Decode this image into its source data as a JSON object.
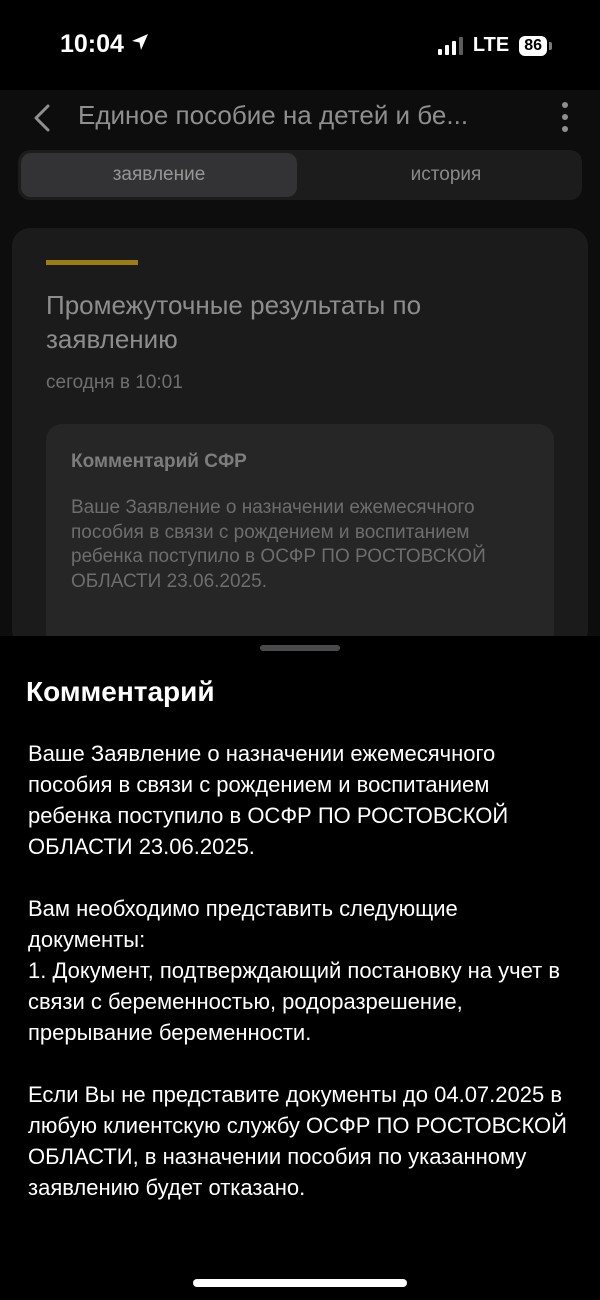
{
  "status_bar": {
    "time": "10:04",
    "network": "LTE",
    "battery": "86",
    "signal_bars_active": 3,
    "signal_bars_total": 4
  },
  "header": {
    "title": "Единое пособие на детей и бе..."
  },
  "tabs": {
    "application_label": "заявление",
    "history_label": "история"
  },
  "result_card": {
    "title": "Промежуточные результаты по заявлению",
    "date": "сегодня в 10:01",
    "comment_label": "Комментарий СФР",
    "comment_preview": "Ваше Заявление о назначении ежемесячного пособия в связи с рождением и воспитанием ребенка поступило в ОСФР ПО РОСТОВСКОЙ ОБЛАСТИ 23.06.2025."
  },
  "sheet": {
    "title": "Комментарий",
    "paragraph_1": "Ваше Заявление о назначении ежемесячного пособия в связи с рождением и воспитанием ребенка поступило в ОСФР ПО РОСТОВСКОЙ ОБЛАСТИ 23.06.2025.",
    "paragraph_2": "Вам необходимо представить следующие документы:\n1. Документ, подтверждающий постановку на учет в связи с беременностью, родоразрешение, прерывание беременности.",
    "paragraph_3": "Если Вы не представите документы до 04.07.2025 в любую клиентскую службу ОСФР ПО РОСТОВСКОЙ ОБЛАСТИ, в назначении пособия по указанному заявлению будет отказано."
  },
  "colors": {
    "accent": "#9c7e10",
    "background": "#000000",
    "card": "#1b1b1c"
  }
}
